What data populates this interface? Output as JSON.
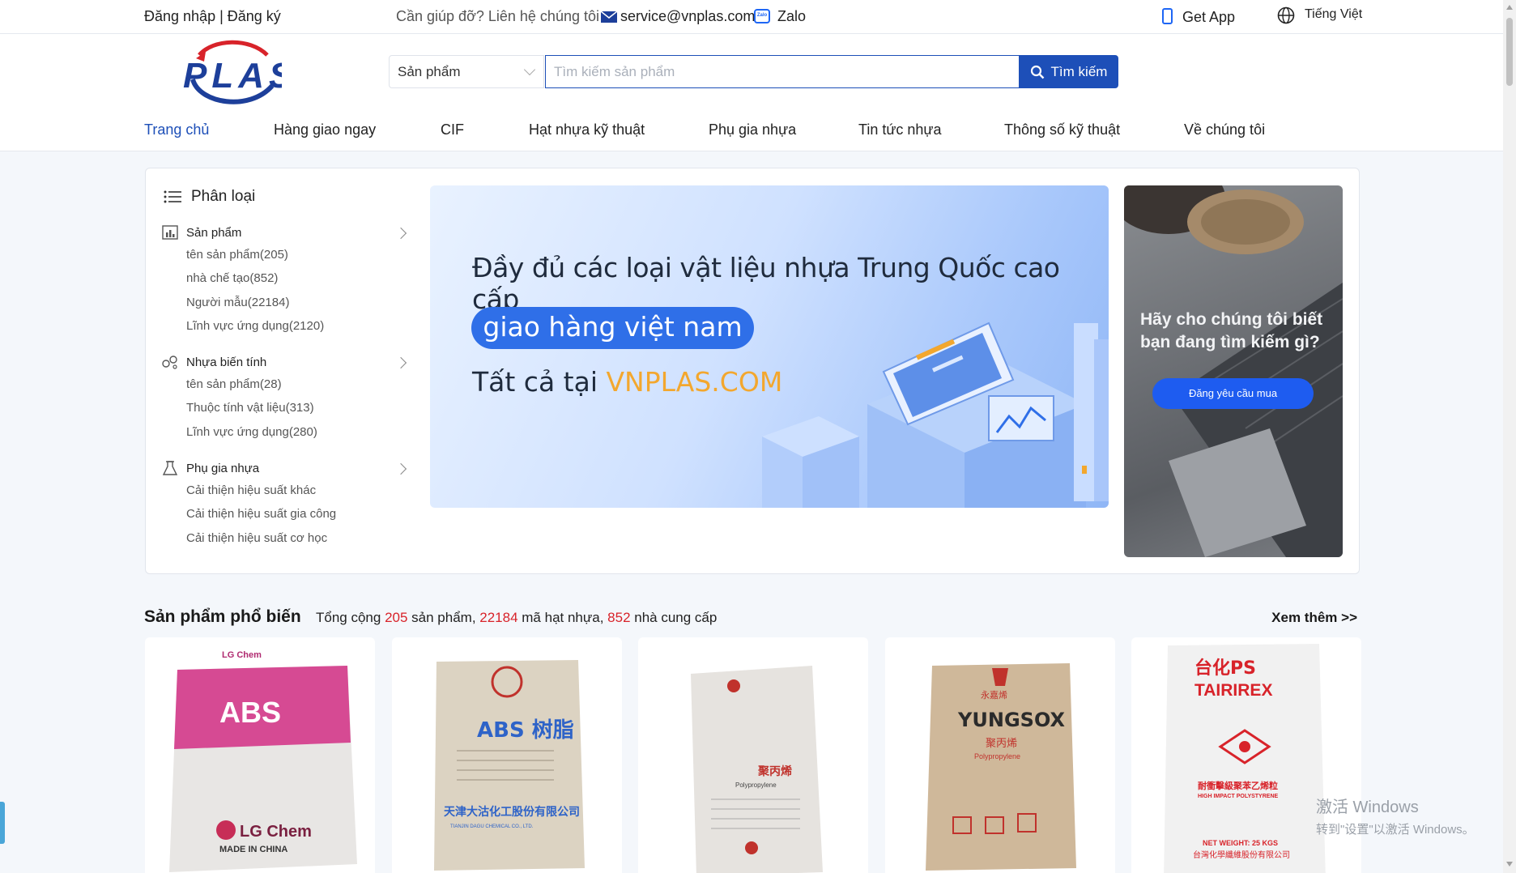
{
  "topbar": {
    "login": "Đăng nhập | Đăng ký",
    "help": "Cần giúp đỡ? Liên hệ chúng tôi",
    "email": "service@vnplas.com",
    "zalo": "Zalo",
    "zalo_icon_text": "Zalo",
    "get_app": "Get App",
    "language": "Tiếng Việt"
  },
  "header": {
    "logo_text": "PLAS",
    "search": {
      "category": "Sản phẩm",
      "placeholder": "Tìm kiếm sản phẩm",
      "button": "Tìm kiếm"
    },
    "nav": [
      {
        "label": "Trang chủ",
        "active": true
      },
      {
        "label": "Hàng giao ngay"
      },
      {
        "label": "CIF"
      },
      {
        "label": "Hạt nhựa kỹ thuật"
      },
      {
        "label": "Phụ gia nhựa"
      },
      {
        "label": "Tin tức nhựa"
      },
      {
        "label": "Thông số kỹ thuật"
      },
      {
        "label": "Về chúng tôi"
      }
    ]
  },
  "categories": {
    "title": "Phân loại",
    "groups": [
      {
        "label": "Sản phẩm",
        "items": [
          "tên sản phẩm(205)",
          "nhà chế tạo(852)",
          "Người mẫu(22184)",
          "Lĩnh vực ứng dụng(2120)"
        ]
      },
      {
        "label": "Nhựa biến tính",
        "items": [
          "tên sản phẩm(28)",
          "Thuộc tính vật liệu(313)",
          "Lĩnh vực ứng dụng(280)"
        ]
      },
      {
        "label": "Phụ gia nhựa",
        "items": [
          "Cải thiện hiệu suất khác",
          "Cải thiện hiệu suất gia công",
          "Cải thiện hiệu suất cơ học"
        ]
      }
    ]
  },
  "banner": {
    "line1": "Đầy đủ các loại vật liệu nhựa Trung Quốc cao cấp",
    "pill": "giao hàng việt nam",
    "line3_prefix": "Tất cả tại ",
    "line3_brand": "VNPLAS.COM"
  },
  "side_promo": {
    "text": "Hãy cho chúng tôi biết bạn đang tìm kiếm gì?",
    "button": "Đăng yêu cầu mua"
  },
  "popular": {
    "title": "Sản phẩm phổ biến",
    "stats_prefix": "Tổng cộng ",
    "products": "205",
    "products_label": " sản phẩm, ",
    "grades": "22184",
    "grades_label": " mã hạt nhựa, ",
    "suppliers": "852",
    "suppliers_label": " nhà cung cấp",
    "more": "Xem thêm >>",
    "cards": [
      {
        "brand": "LG Chem",
        "title": "ABS",
        "footer": "LG Chem",
        "sub": "MADE IN CHINA",
        "color": "#d64a93"
      },
      {
        "brand": "",
        "title": "ABS 树脂",
        "footer": "天津大沽化工股份有限公司",
        "sub": "TIANJIN DAGU CHEMICAL CO., LTD.",
        "color": "#2e63c8"
      },
      {
        "brand": "",
        "title": "聚丙烯",
        "footer": "",
        "sub": "Polypropylene",
        "color": "#c0322c"
      },
      {
        "brand": "永嘉烯",
        "title": "YUNGSOX",
        "footer": "聚丙烯",
        "sub": "Polypropylene",
        "color": "#c0322c"
      },
      {
        "brand": "台化PS",
        "title": "TAIRIREX",
        "footer": "耐衝擊級聚苯乙烯粒",
        "sub": "HIGH IMPACT POLYSTYRENE",
        "net": "NET WEIGHT: 25 KGS",
        "maker": "台灣化學纖維股份有限公司",
        "color": "#d8232a"
      }
    ]
  },
  "watermark": {
    "line1": "激活 Windows",
    "line2": "转到\"设置\"以激活 Windows。"
  }
}
